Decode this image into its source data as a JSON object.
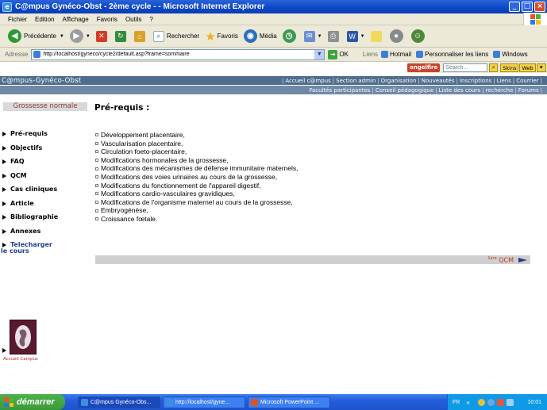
{
  "window": {
    "title": "C@mpus Gynéco-Obst - 2ème cycle - - Microsoft Internet Explorer",
    "buttons": [
      "_",
      "□",
      "×"
    ]
  },
  "menubar": [
    "Fichier",
    "Edition",
    "Affichage",
    "Favoris",
    "Outils",
    "?"
  ],
  "toolbar": {
    "back": "Précédente",
    "search": "Rechercher",
    "favorites": "Favoris",
    "media": "Média"
  },
  "address": {
    "label": "Adresse",
    "url": "http://localhost/gyneco/cycle2/default.asp?frame=sommaire",
    "go": "OK",
    "links_label": "Liens",
    "links": [
      "Hotmail",
      "Personnaliser les liens",
      "Windows"
    ]
  },
  "angelfire": {
    "brand": "angelfire",
    "search_placeholder": "Search...",
    "buttons": [
      "Skins",
      "Web"
    ]
  },
  "site": {
    "brand": "C@mpus-Gynéco-Obst",
    "topnav": [
      "Accueil c@mpus",
      "Section admin",
      "Organisation",
      "Nouveautés",
      "Inscriptions",
      "Liens",
      "Courrier"
    ],
    "subnav": [
      "Facultés participantes",
      "Conseil pédagogique",
      "Liste des cours",
      "recherche",
      "Forums"
    ],
    "section": "Grossesse normale",
    "sidenav": [
      "Pré-requis",
      "Objectifs",
      "FAQ",
      "QCM",
      "Cas cliniques",
      "Article",
      "Bibliographie",
      "Annexes"
    ],
    "download": [
      "Telecharger",
      "le cours"
    ],
    "logo_caption": "Accueil Campus",
    "heading": "Pré-requis :",
    "items": [
      "Développement placentaire,",
      "Vascularisation placentaire,",
      "Circulation foeto-placentaire,",
      "Modifications hormonales de la grossesse,",
      "Modifications des mécanismes de défense immunitaire maternels,",
      "Modifications des voies urinaires au cours de la grossesse,",
      "Modifications du fonctionnement de l'appareil digestif,",
      "Modifications cardio-vasculaires gravidiques,",
      "Modifications de l'organisme maternel au cours de la grossesse,",
      "Embryogénèse,",
      "Croissance fœtale."
    ],
    "next_sup": "1ère",
    "next_link": "QCM"
  },
  "taskbar": {
    "start": "démarrer",
    "tasks": [
      "C@mpus Gynéco-Obs...",
      "http://localhost/gyne...",
      "Microsoft PowerPoint ..."
    ],
    "lang": "FR",
    "clock": "10:01"
  },
  "colors": {
    "sitebar": "#4f6d8d",
    "subbar": "#6f89a7",
    "section_text": "#8a3a3a",
    "next_link": "#c0391b"
  }
}
